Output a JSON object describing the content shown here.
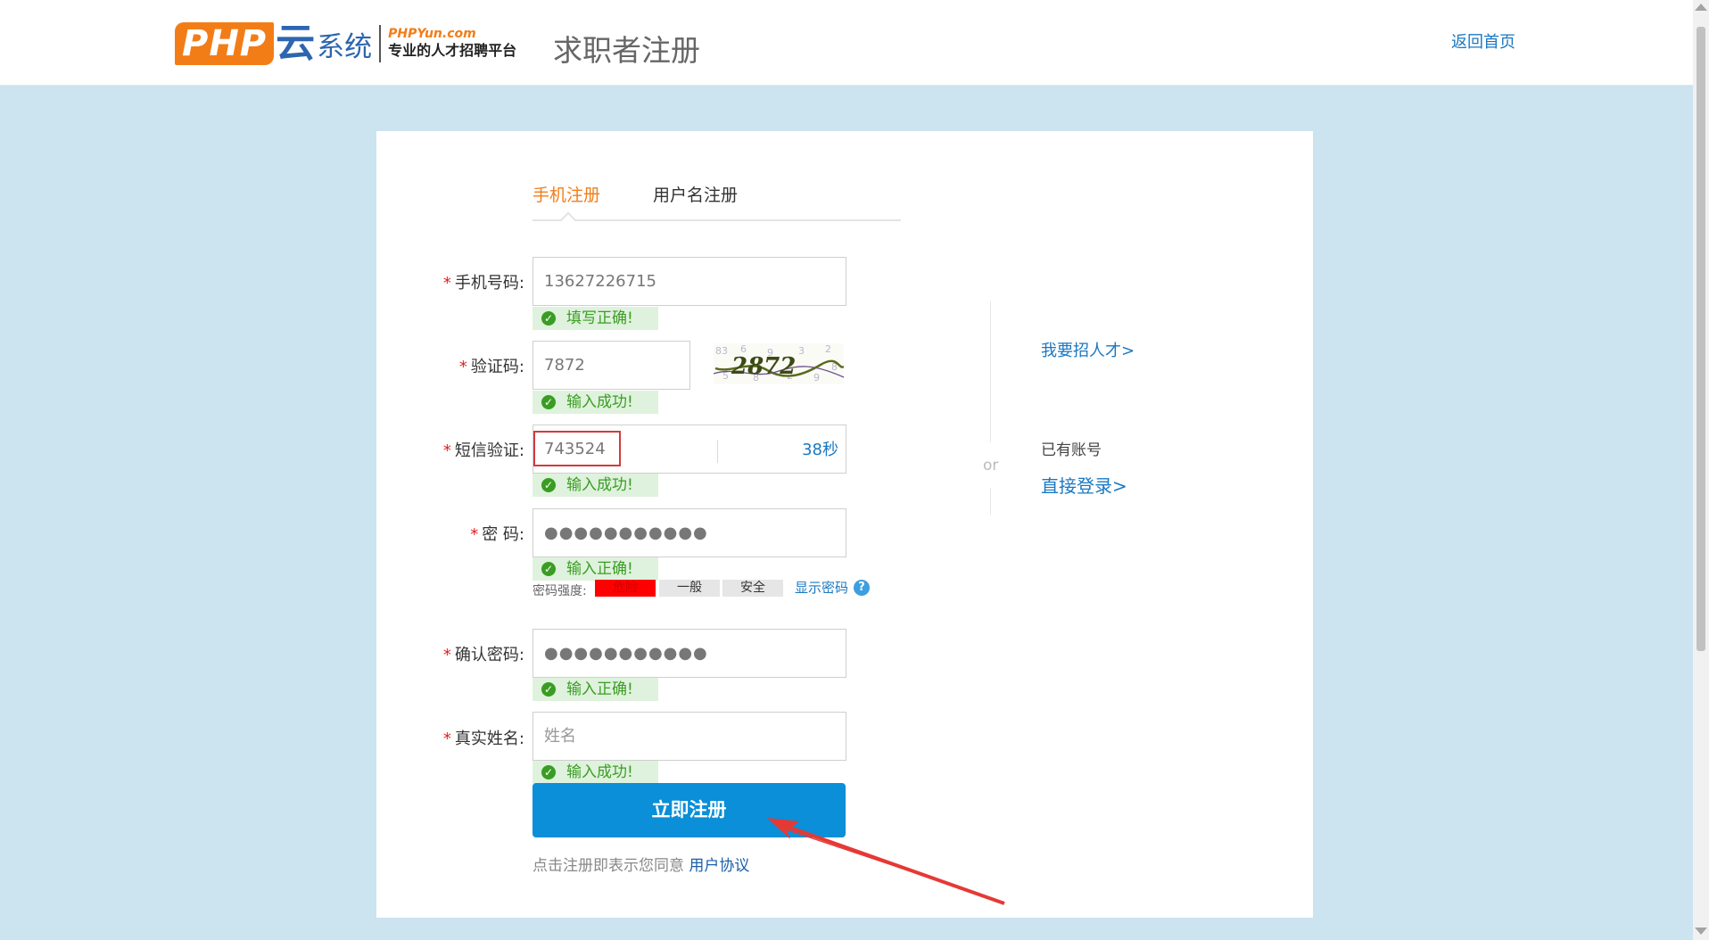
{
  "header": {
    "logo_php": "PHP",
    "logo_yun": "云",
    "logo_system": "系统",
    "logo_domain": "PHPYun.com",
    "logo_slogan": "专业的人才招聘平台",
    "page_title": "求职者注册",
    "home_link": "返回首页"
  },
  "tabs": [
    {
      "label": "手机注册",
      "active": true
    },
    {
      "label": "用户名注册",
      "active": false
    }
  ],
  "form": {
    "required_mark": "*",
    "phone": {
      "label": "手机号码:",
      "value": "13627226715",
      "status": "填写正确!"
    },
    "captcha": {
      "label": "验证码:",
      "value": "7872",
      "status": "输入成功!",
      "image_text": "2872"
    },
    "sms": {
      "label": "短信验证:",
      "value": "743524",
      "countdown": "38秒",
      "status": "输入成功!"
    },
    "password": {
      "label": "密 码:",
      "value": "●●●●●●●●●●●",
      "status": "输入正确!"
    },
    "strength": {
      "label": "密码强度:",
      "levels": [
        "危险",
        "一般",
        "安全"
      ],
      "show_password": "显示密码",
      "help": "?"
    },
    "confirm_password": {
      "label": "确认密码:",
      "value": "●●●●●●●●●●●",
      "status": "输入正确!"
    },
    "real_name": {
      "label": "真实姓名:",
      "placeholder": "姓名",
      "status": "输入成功!"
    },
    "submit_label": "立即注册",
    "agreement_prefix": "点击注册即表示您同意",
    "agreement_link": "用户协议"
  },
  "side": {
    "or": "or",
    "recruit_link": "我要招人才>",
    "has_account": "已有账号",
    "login_link": "直接登录>"
  },
  "colors": {
    "page_bg": "#cce3f0",
    "accent": "#f27d17",
    "link": "#1a78c2",
    "submit": "#0a8fd8",
    "success": "#3a9d23",
    "danger": "#ff0000"
  }
}
